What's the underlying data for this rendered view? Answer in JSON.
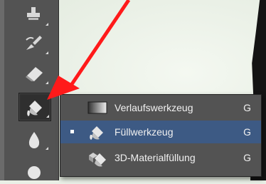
{
  "toolbar": {
    "tools": [
      {
        "icon": "stamp-icon"
      },
      {
        "icon": "history-brush-icon"
      },
      {
        "icon": "eraser-icon"
      },
      {
        "icon": "paint-bucket-icon",
        "active": true
      },
      {
        "icon": "blur-icon"
      },
      {
        "icon": "dodge-icon"
      }
    ]
  },
  "flyout": {
    "items": [
      {
        "label": "Verlaufswerkzeug",
        "shortcut": "G",
        "icon": "gradient-icon",
        "selected": false
      },
      {
        "label": "Füllwerkzeug",
        "shortcut": "G",
        "icon": "paint-bucket-icon",
        "selected": true
      },
      {
        "label": "3D-Materialfüllung",
        "shortcut": "G",
        "icon": "3d-material-drop-icon",
        "selected": false
      }
    ]
  },
  "colors": {
    "panel": "#535353",
    "highlight": "#3d5a84",
    "annotation": "#ff1a1a"
  }
}
